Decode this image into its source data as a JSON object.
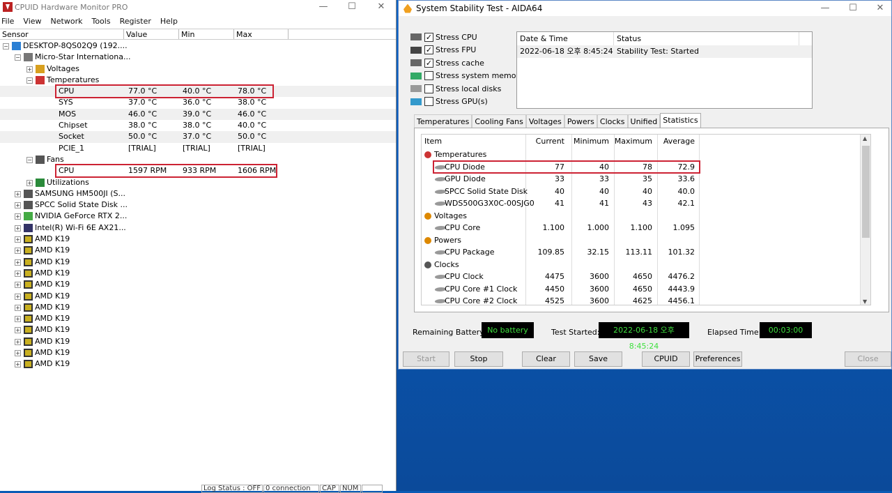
{
  "hwmonitor": {
    "title": "CPUID Hardware Monitor PRO",
    "menu": [
      "File",
      "View",
      "Network",
      "Tools",
      "Register",
      "Help"
    ],
    "columns": [
      "Sensor",
      "Value",
      "Min",
      "Max"
    ],
    "tree": [
      {
        "label": "DESKTOP-8QS02Q9 (192....",
        "level": 0,
        "exp": "−",
        "icon": "computer"
      },
      {
        "label": "Micro-Star Internationa...",
        "level": 1,
        "exp": "−",
        "icon": "board"
      },
      {
        "label": "Voltages",
        "level": 2,
        "exp": "+",
        "icon": "volt"
      },
      {
        "label": "Temperatures",
        "level": 2,
        "exp": "−",
        "icon": "temp"
      },
      {
        "label": "CPU",
        "level": 3,
        "value": "77.0 °C",
        "min": "40.0 °C",
        "max": "78.0 °C",
        "hl": true
      },
      {
        "label": "SYS",
        "level": 3,
        "value": "37.0 °C",
        "min": "36.0 °C",
        "max": "38.0 °C"
      },
      {
        "label": "MOS",
        "level": 3,
        "value": "46.0 °C",
        "min": "39.0 °C",
        "max": "46.0 °C"
      },
      {
        "label": "Chipset",
        "level": 3,
        "value": "38.0 °C",
        "min": "38.0 °C",
        "max": "40.0 °C"
      },
      {
        "label": "Socket",
        "level": 3,
        "value": "50.0 °C",
        "min": "37.0 °C",
        "max": "50.0 °C"
      },
      {
        "label": "PCIE_1",
        "level": 3,
        "value": "[TRIAL]",
        "min": "[TRIAL]",
        "max": "[TRIAL]"
      },
      {
        "label": "Fans",
        "level": 2,
        "exp": "−",
        "icon": "fan"
      },
      {
        "label": "CPU",
        "level": 3,
        "value": "1597 RPM",
        "min": "933 RPM",
        "max": "1606 RPM",
        "hl": true
      },
      {
        "label": "Utilizations",
        "level": 2,
        "exp": "+",
        "icon": "util"
      },
      {
        "label": "SAMSUNG HM500JI (S...",
        "level": 1,
        "exp": "+",
        "icon": "disk"
      },
      {
        "label": "SPCC Solid State Disk ...",
        "level": 1,
        "exp": "+",
        "icon": "disk"
      },
      {
        "label": "NVIDIA GeForce RTX 2...",
        "level": 1,
        "exp": "+",
        "icon": "gpu"
      },
      {
        "label": "Intel(R) Wi-Fi 6E AX21...",
        "level": 1,
        "exp": "+",
        "icon": "wifi"
      },
      {
        "label": "AMD K19",
        "level": 1,
        "exp": "+",
        "icon": "chip"
      },
      {
        "label": "AMD K19",
        "level": 1,
        "exp": "+",
        "icon": "chip"
      },
      {
        "label": "AMD K19",
        "level": 1,
        "exp": "+",
        "icon": "chip"
      },
      {
        "label": "AMD K19",
        "level": 1,
        "exp": "+",
        "icon": "chip"
      },
      {
        "label": "AMD K19",
        "level": 1,
        "exp": "+",
        "icon": "chip"
      },
      {
        "label": "AMD K19",
        "level": 1,
        "exp": "+",
        "icon": "chip"
      },
      {
        "label": "AMD K19",
        "level": 1,
        "exp": "+",
        "icon": "chip"
      },
      {
        "label": "AMD K19",
        "level": 1,
        "exp": "+",
        "icon": "chip"
      },
      {
        "label": "AMD K19",
        "level": 1,
        "exp": "+",
        "icon": "chip"
      },
      {
        "label": "AMD K19",
        "level": 1,
        "exp": "+",
        "icon": "chip"
      },
      {
        "label": "AMD K19",
        "level": 1,
        "exp": "+",
        "icon": "chip"
      },
      {
        "label": "AMD K19",
        "level": 1,
        "exp": "+",
        "icon": "chip"
      }
    ],
    "status": [
      "Log Status : OFF",
      "0 connection",
      "CAP",
      "NUM"
    ]
  },
  "aida": {
    "title": "System Stability Test - AIDA64",
    "stress": [
      {
        "label": "Stress CPU",
        "checked": "✓"
      },
      {
        "label": "Stress FPU",
        "checked": "✓"
      },
      {
        "label": "Stress cache",
        "checked": "✓"
      },
      {
        "label": "Stress system memory",
        "checked": ""
      },
      {
        "label": "Stress local disks",
        "checked": ""
      },
      {
        "label": "Stress GPU(s)",
        "checked": ""
      }
    ],
    "log_headers": [
      "Date & Time",
      "Status"
    ],
    "log_row": [
      "2022-06-18 오후 8:45:24",
      "Stability Test: Started"
    ],
    "tabs": [
      "Temperatures",
      "Cooling Fans",
      "Voltages",
      "Powers",
      "Clocks",
      "Unified",
      "Statistics"
    ],
    "stat_headers": [
      "Item",
      "Current",
      "Minimum",
      "Maximum",
      "Average"
    ],
    "stat_rows": [
      {
        "name": "Temperatures",
        "group": true,
        "icon": "temp"
      },
      {
        "name": "CPU Diode",
        "cur": "77",
        "min": "40",
        "max": "78",
        "avg": "72.9",
        "hl": true
      },
      {
        "name": "GPU Diode",
        "cur": "33",
        "min": "33",
        "max": "35",
        "avg": "33.6"
      },
      {
        "name": "SPCC Solid State Disk",
        "cur": "40",
        "min": "40",
        "max": "40",
        "avg": "40.0"
      },
      {
        "name": "WDS500G3X0C-00SJG0",
        "cur": "41",
        "min": "41",
        "max": "43",
        "avg": "42.1"
      },
      {
        "name": "Voltages",
        "group": true,
        "icon": "volt"
      },
      {
        "name": "CPU Core",
        "cur": "1.100",
        "min": "1.000",
        "max": "1.100",
        "avg": "1.095"
      },
      {
        "name": "Powers",
        "group": true,
        "icon": "power"
      },
      {
        "name": "CPU Package",
        "cur": "109.85",
        "min": "32.15",
        "max": "113.11",
        "avg": "101.32"
      },
      {
        "name": "Clocks",
        "group": true,
        "icon": "clock"
      },
      {
        "name": "CPU Clock",
        "cur": "4475",
        "min": "3600",
        "max": "4650",
        "avg": "4476.2"
      },
      {
        "name": "CPU Core #1 Clock",
        "cur": "4450",
        "min": "3600",
        "max": "4650",
        "avg": "4443.9"
      },
      {
        "name": "CPU Core #2 Clock",
        "cur": "4525",
        "min": "3600",
        "max": "4625",
        "avg": "4456.1"
      }
    ],
    "remaining_battery_label": "Remaining Battery:",
    "remaining_battery": "No battery",
    "test_started_label": "Test Started:",
    "test_started": "2022-06-18 오후 8:45:24",
    "elapsed_label": "Elapsed Time:",
    "elapsed": "00:03:00",
    "buttons": {
      "start": "Start",
      "stop": "Stop",
      "clear": "Clear",
      "save": "Save",
      "cpuid": "CPUID",
      "preferences": "Preferences",
      "close": "Close"
    }
  }
}
